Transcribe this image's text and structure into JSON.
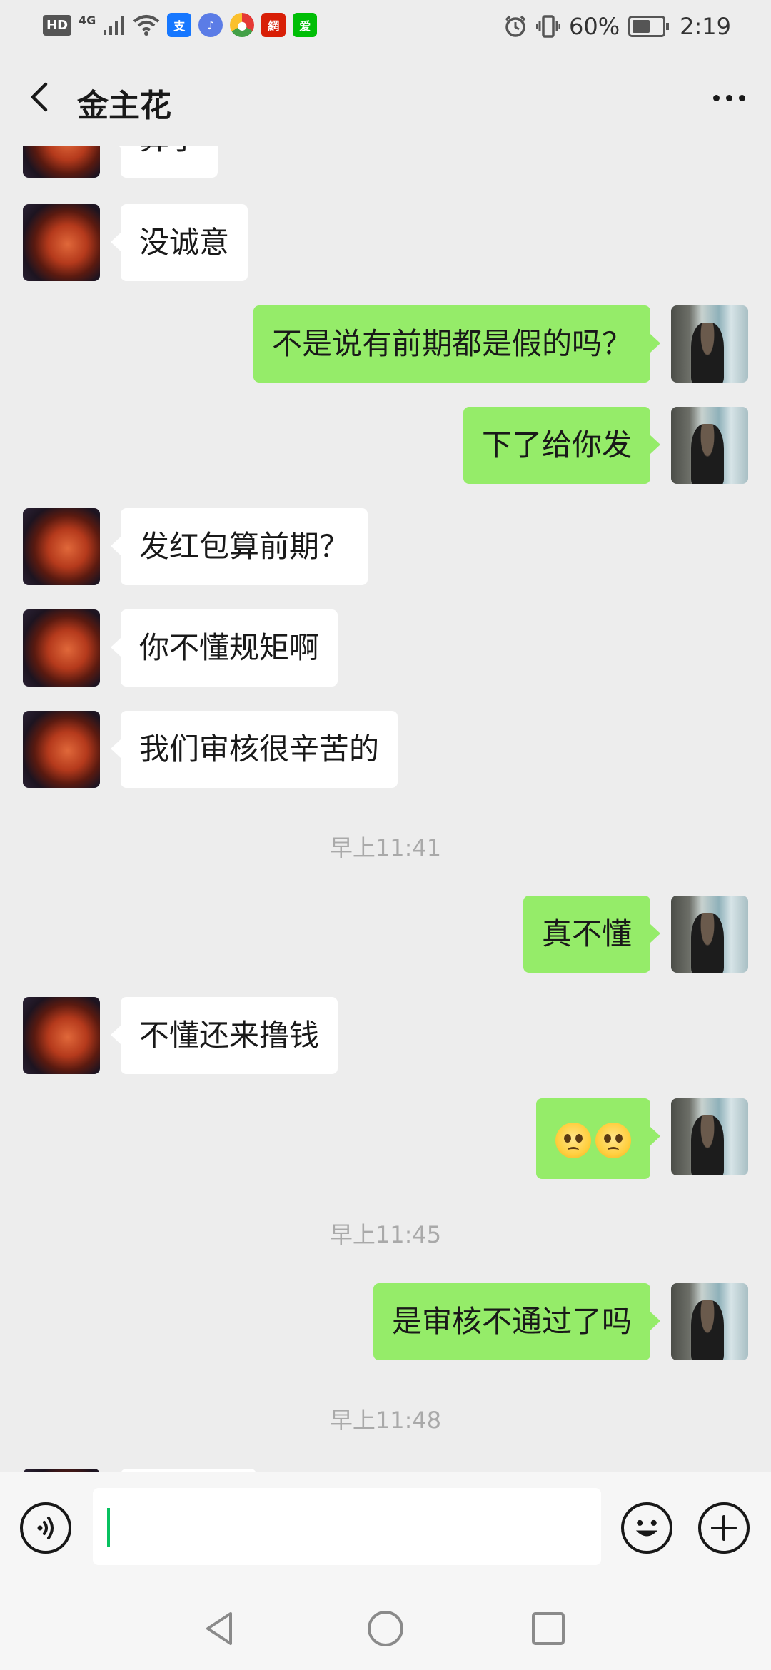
{
  "status_bar": {
    "network": "4G",
    "battery": "60%",
    "battery_level": 0.6,
    "time": "2:19",
    "hd_label": "HD",
    "app_icons": [
      "alipay-icon",
      "music-icon",
      "browser-icon",
      "netease-icon",
      "iqiyi-icon"
    ]
  },
  "header": {
    "title": "金主花"
  },
  "messages": [
    {
      "side": "other",
      "text": "算了"
    },
    {
      "side": "other",
      "text": "没诚意"
    },
    {
      "side": "me",
      "text": "不是说有前期都是假的吗？"
    },
    {
      "side": "me",
      "text": "下了给你发"
    },
    {
      "side": "other",
      "text": "发红包算前期？"
    },
    {
      "side": "other",
      "text": "你不懂规矩啊"
    },
    {
      "side": "other",
      "text": "我们审核很辛苦的"
    },
    {
      "type": "timestamp",
      "text": "早上11:41"
    },
    {
      "side": "me",
      "text": "真不懂"
    },
    {
      "side": "other",
      "text": "不懂还来撸钱"
    },
    {
      "side": "me",
      "type": "emoji",
      "emoji": [
        "pleading-face",
        "pleading-face"
      ]
    },
    {
      "type": "timestamp",
      "text": "早上11:45"
    },
    {
      "side": "me",
      "text": "是审核不通过了吗"
    },
    {
      "type": "timestamp",
      "text": "早上11:48"
    }
  ],
  "input_bar": {
    "value": "",
    "placeholder": ""
  },
  "colors": {
    "background": "#ededed",
    "my_bubble": "#95ec69",
    "other_bubble": "#ffffff",
    "caret": "#07c160"
  }
}
